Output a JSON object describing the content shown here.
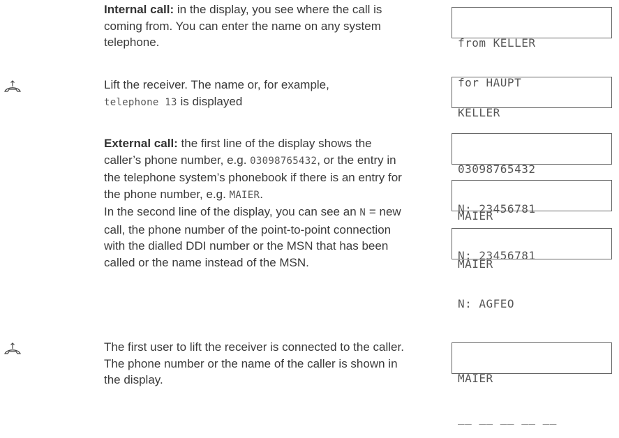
{
  "internal_call": {
    "heading": "Internal call:",
    "text": " in the display, you see where the call is coming from. You can enter the name on any system telephone."
  },
  "lift_receiver": {
    "text_before": "Lift the receiver. The name or, for example,",
    "code": "telephone 13",
    "text_after": " is displayed"
  },
  "external_call": {
    "heading": "External call:",
    "text1": " the first line of the display shows the caller’s phone number, e.g. ",
    "code1": "03098765432",
    "text2": ", or the entry in the telephone system’s phonebook if there is an entry for the phone number, e.g. ",
    "code2": "MAIER",
    "text3": ".",
    "text4": "In the second line of the display, you can see an ",
    "code3": "N",
    "text5": " = new call, the phone number of the point-to-point connection with the dialled DDI number or the MSN that has been called or the name instead of the MSN."
  },
  "first_user": {
    "text": "The first user to lift the receiver is connected to the caller. The phone number or the name of the caller is shown in the display."
  },
  "displays": [
    {
      "line1": "from KELLER",
      "line2": "for HAUPT"
    },
    {
      "line1": "KELLER",
      "line2": ""
    },
    {
      "line1": "03098765432",
      "line2": "N: 23456781"
    },
    {
      "line1": "MAIER",
      "line2": "N: 23456781"
    },
    {
      "line1": "MAIER",
      "line2": "N: AGFEO"
    },
    {
      "line1": "MAIER",
      "line2": "__ __ __ __ __"
    }
  ],
  "icons": [
    "handset-lift-icon",
    "handset-lift-icon"
  ]
}
